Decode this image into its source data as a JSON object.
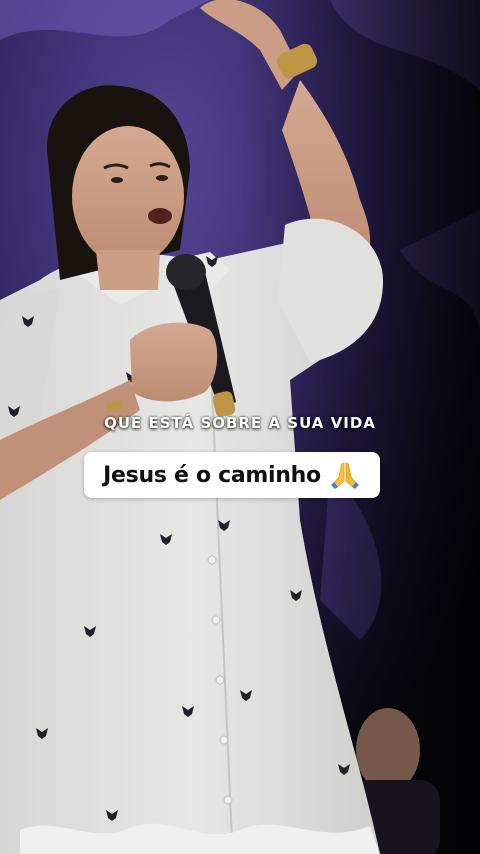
{
  "video": {
    "subtitle_top": "QUE ESTÁ SOBRE A SUA VIDA",
    "caption": "Jesus é o caminho",
    "caption_emoji": "folded-hands-icon"
  },
  "colors": {
    "background_purple": "#4a3a86",
    "dress_white": "#f1f1ef",
    "caption_bg": "#ffffff",
    "caption_text": "#111111",
    "emoji_yellow": "#f6c338"
  }
}
